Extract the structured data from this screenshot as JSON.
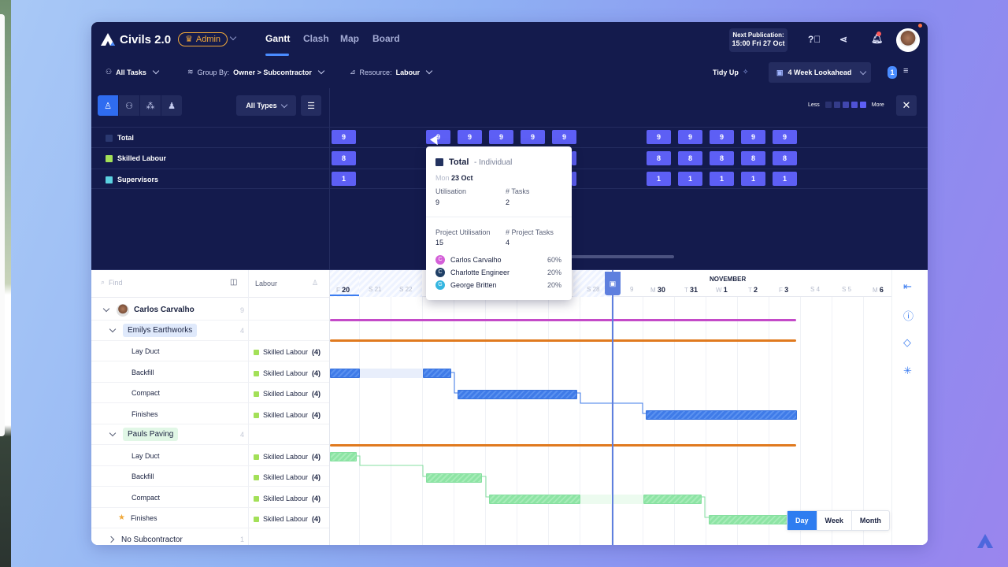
{
  "app": {
    "name": "Civils 2.0",
    "role_badge": "Admin",
    "tabs": [
      "Gantt",
      "Clash",
      "Map",
      "Board"
    ],
    "active_tab": "Gantt",
    "next_publication_label": "Next Publication:",
    "next_publication_value": "15:00 Fri 27 Oct"
  },
  "filters": {
    "tasks": "All Tasks",
    "group_prefix": "Group By:",
    "group_value": "Owner > Subcontractor",
    "resource_prefix": "Resource:",
    "resource_value": "Labour",
    "tidy_up": "Tidy Up",
    "lookahead": "4 Week Lookahead",
    "filter_count": "1"
  },
  "resource_panel": {
    "all_types": "All Types",
    "legend_less": "Less",
    "legend_more": "More",
    "rows": [
      {
        "name": "Total",
        "color": "#23325f",
        "values": [
          "9",
          "9",
          "9",
          "9",
          "9",
          "9",
          "9",
          "9",
          "9",
          "9",
          "9"
        ]
      },
      {
        "name": "Skilled Labour",
        "color": "#a3e058",
        "values": [
          "8",
          "8",
          "8",
          "8",
          "8",
          "8"
        ]
      },
      {
        "name": "Supervisors",
        "color": "#5bd1e0",
        "values": [
          "1",
          "1",
          "1",
          "1",
          "1",
          "1"
        ]
      }
    ]
  },
  "tooltip": {
    "title": "Total",
    "subtitle": "- Individual",
    "day": "Mon",
    "date": "23 Oct",
    "utilisation_label": "Utilisation",
    "utilisation_value": "9",
    "tasks_label": "# Tasks",
    "tasks_value": "2",
    "project_util_label": "Project Utilisation",
    "project_util_value": "15",
    "project_tasks_label": "# Project Tasks",
    "project_tasks_value": "4",
    "people": [
      {
        "initial": "C",
        "name": "Carlos Carvalho",
        "pct": "60%",
        "color": "#d45fd8"
      },
      {
        "initial": "C",
        "name": "Charlotte Engineer",
        "pct": "20%",
        "color": "#1f3f66"
      },
      {
        "initial": "G",
        "name": "George Britten",
        "pct": "20%",
        "color": "#35b6e0"
      }
    ]
  },
  "task_list": {
    "find_placeholder": "Find",
    "labour_header": "Labour",
    "owner": {
      "name": "Carlos Carvalho",
      "count": "9"
    },
    "groups": [
      {
        "name": "Emilys Earthworks",
        "count": "4",
        "tasks": [
          {
            "name": "Lay Duct",
            "res": "Skilled Labour",
            "qty": "(4)"
          },
          {
            "name": "Backfill",
            "res": "Skilled Labour",
            "qty": "(4)"
          },
          {
            "name": "Compact",
            "res": "Skilled Labour",
            "qty": "(4)"
          },
          {
            "name": "Finishes",
            "res": "Skilled Labour",
            "qty": "(4)"
          }
        ]
      },
      {
        "name": "Pauls Paving",
        "count": "4",
        "tasks": [
          {
            "name": "Lay Duct",
            "res": "Skilled Labour",
            "qty": "(4)"
          },
          {
            "name": "Backfill",
            "res": "Skilled Labour",
            "qty": "(4)"
          },
          {
            "name": "Compact",
            "res": "Skilled Labour",
            "qty": "(4)"
          },
          {
            "name": "Finishes",
            "res": "Skilled Labour",
            "qty": "(4)"
          }
        ]
      }
    ],
    "no_sub": {
      "name": "No Subcontractor",
      "count": "1"
    }
  },
  "timeline": {
    "month": "NOVEMBER",
    "days": [
      {
        "d": "F",
        "n": "20"
      },
      {
        "d": "S",
        "n": "21"
      },
      {
        "d": "S",
        "n": "22"
      },
      {
        "d": "S",
        "n": "28"
      },
      {
        "d": "",
        "n": "9"
      },
      {
        "d": "M",
        "n": "30"
      },
      {
        "d": "T",
        "n": "31"
      },
      {
        "d": "W",
        "n": "1"
      },
      {
        "d": "T",
        "n": "2"
      },
      {
        "d": "F",
        "n": "3"
      },
      {
        "d": "S",
        "n": "4"
      },
      {
        "d": "S",
        "n": "5"
      },
      {
        "d": "M",
        "n": "6"
      }
    ],
    "scale_buttons": [
      "Day",
      "Week",
      "Month"
    ],
    "active_scale": "Day"
  }
}
